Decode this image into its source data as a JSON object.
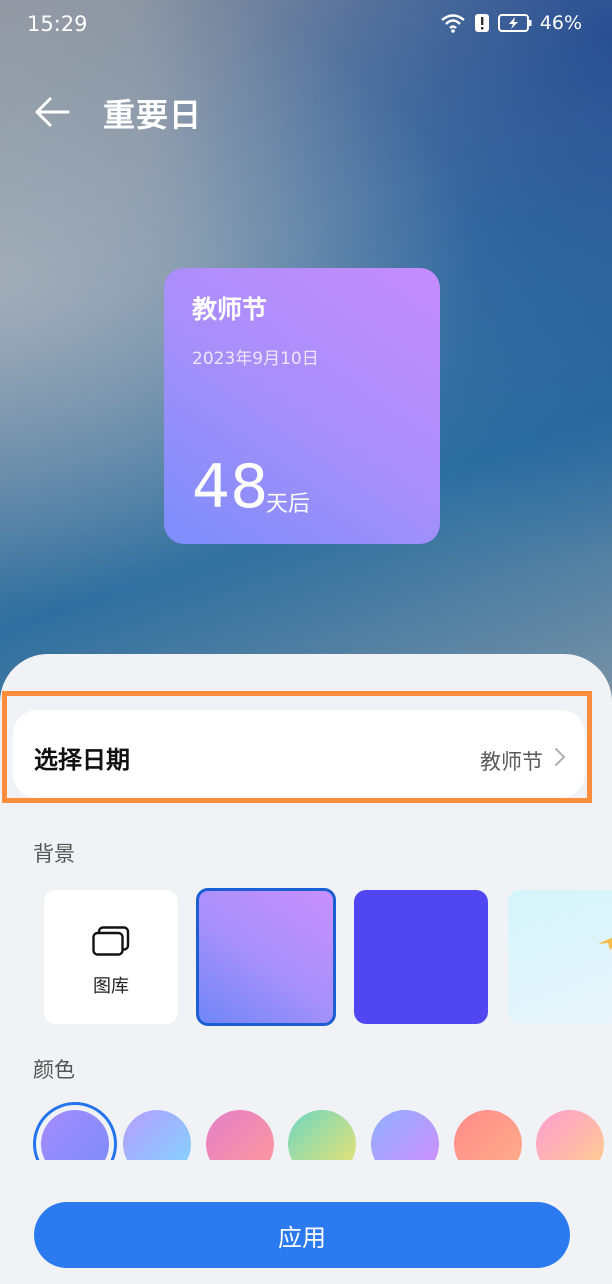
{
  "status_bar": {
    "time": "15:29",
    "battery": "46%"
  },
  "header": {
    "title": "重要日"
  },
  "widget": {
    "name": "教师节",
    "date": "2023年9月10日",
    "count": "48",
    "suffix": "天后"
  },
  "date_row": {
    "label": "选择日期",
    "value": "教师节"
  },
  "background_section": {
    "title": "背景",
    "gallery_label": "图库",
    "tiles": [
      {
        "type": "gallery"
      },
      {
        "type": "gradient",
        "colors": [
          "#c890fd",
          "#6f86f6"
        ],
        "selected": true
      },
      {
        "type": "solid",
        "color": "#5147f2"
      },
      {
        "type": "image",
        "colors": [
          "#d3f5fb",
          "#eaf4fb"
        ]
      }
    ]
  },
  "color_section": {
    "title": "颜色",
    "swatches": [
      {
        "colors": [
          "#a58cff",
          "#7c8cf9"
        ],
        "selected": true
      },
      {
        "colors": [
          "#b69cff",
          "#7fd8ff"
        ]
      },
      {
        "colors": [
          "#e37fc8",
          "#ff9a9a"
        ]
      },
      {
        "colors": [
          "#6fd6c2",
          "#f0e36f"
        ]
      },
      {
        "colors": [
          "#8fb0ff",
          "#d58cff"
        ]
      },
      {
        "colors": [
          "#ff8a8a",
          "#ffb08a"
        ]
      },
      {
        "colors": [
          "#ff9bd2",
          "#ffd18a"
        ]
      }
    ]
  },
  "apply_label": "应用"
}
